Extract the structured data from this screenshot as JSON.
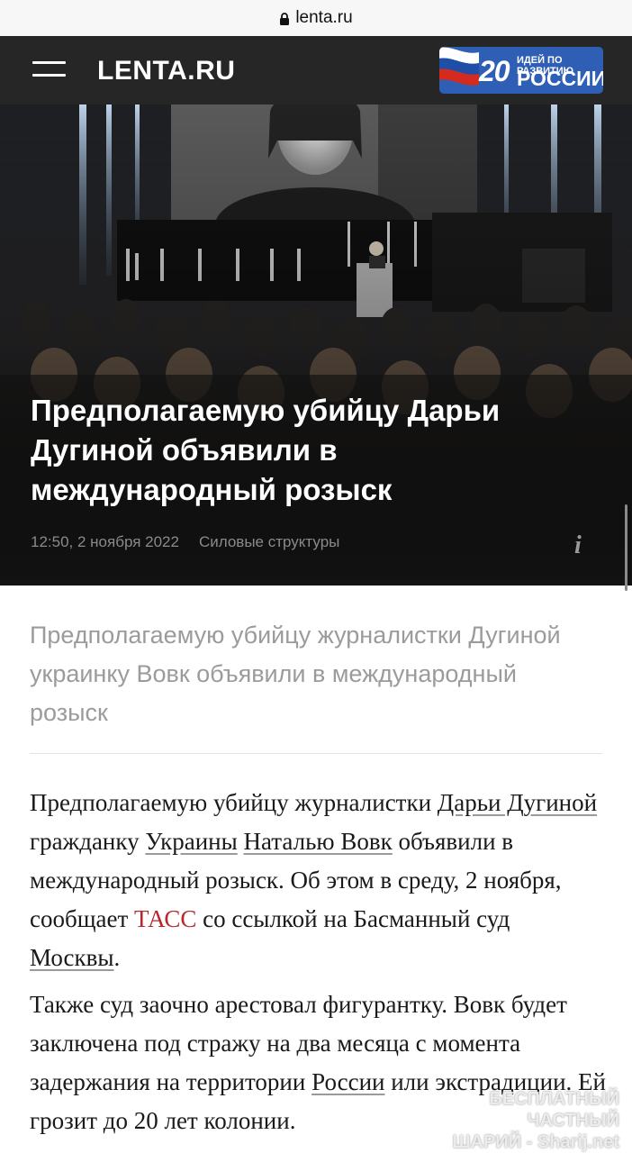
{
  "browser": {
    "url": "lenta.ru"
  },
  "header": {
    "logo": "LENTA.RU",
    "promo": {
      "number": "20",
      "line1": "ИДЕЙ ПО РАЗВИТИЮ",
      "line2": "РОССИИ"
    }
  },
  "hero": {
    "title": "Предполагаемую убийцу Дарьи Дугиной объявили в международный розыск",
    "time": "12:50, 2 ноября 2022",
    "rubric": "Силовые структуры",
    "info_glyph": "i"
  },
  "article": {
    "lead": "Предполагаемую убийцу журналистки Дугиной украинку Вовк объявили в международный розыск",
    "p1": {
      "t1": "Предполагаемую убийцу журналистки ",
      "link_dugina": "Дарьи Дугиной",
      "t2": " гражданку ",
      "link_ukraine": "Украины",
      "t3": " ",
      "link_vovk": "Наталью Вовк",
      "t4": " объявили в международный розыск. Об этом в среду, 2 ноября, сообщает ",
      "link_tass": "ТАСС",
      "t5": " со ссылкой на Басманный суд ",
      "link_moscow": "Москвы",
      "t6": "."
    },
    "p2": {
      "t1": "Также суд заочно арестовал фигурантку. Вовк будет заключена под стражу на два месяца с момента задержания на территории ",
      "link_russia": "России",
      "t2": " или экстрадиции. Ей грозит до 20 лет колонии."
    }
  },
  "watermark": {
    "line1": "БЕСПЛАТНЫЙ ЧАСТНЫЙ",
    "line2": "ШАРИЙ - Sharij.net"
  },
  "colors": {
    "header_bg": "#262626",
    "source_link": "#b8272d",
    "promo_bg": "#2f5fb5"
  }
}
